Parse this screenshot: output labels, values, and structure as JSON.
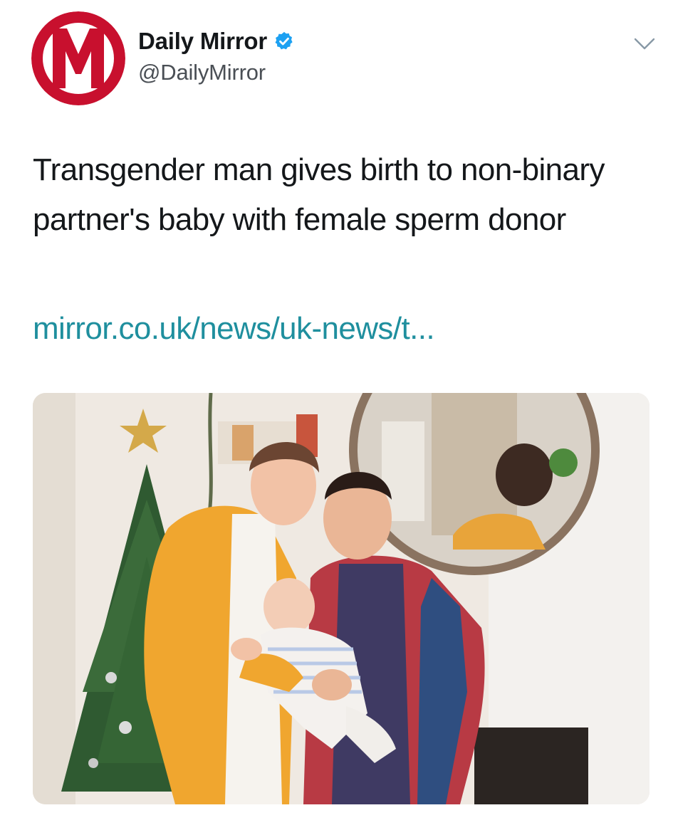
{
  "account": {
    "display_name": "Daily Mirror",
    "handle": "@DailyMirror",
    "avatar_icon": "daily-mirror-logo",
    "logo_letter": "M",
    "verified_icon": "verified-badge-icon",
    "brand_color": "#c8102e",
    "verified_color": "#1da1f2"
  },
  "tweet": {
    "text": "Transgender man gives birth to non-binary partner's baby with female sperm donor",
    "link_text": "mirror.co.uk/news/uk-news/t...",
    "link_color": "#1f8f9e"
  },
  "menu": {
    "caret_icon": "chevron-down-icon"
  },
  "media": {
    "type": "photo"
  }
}
